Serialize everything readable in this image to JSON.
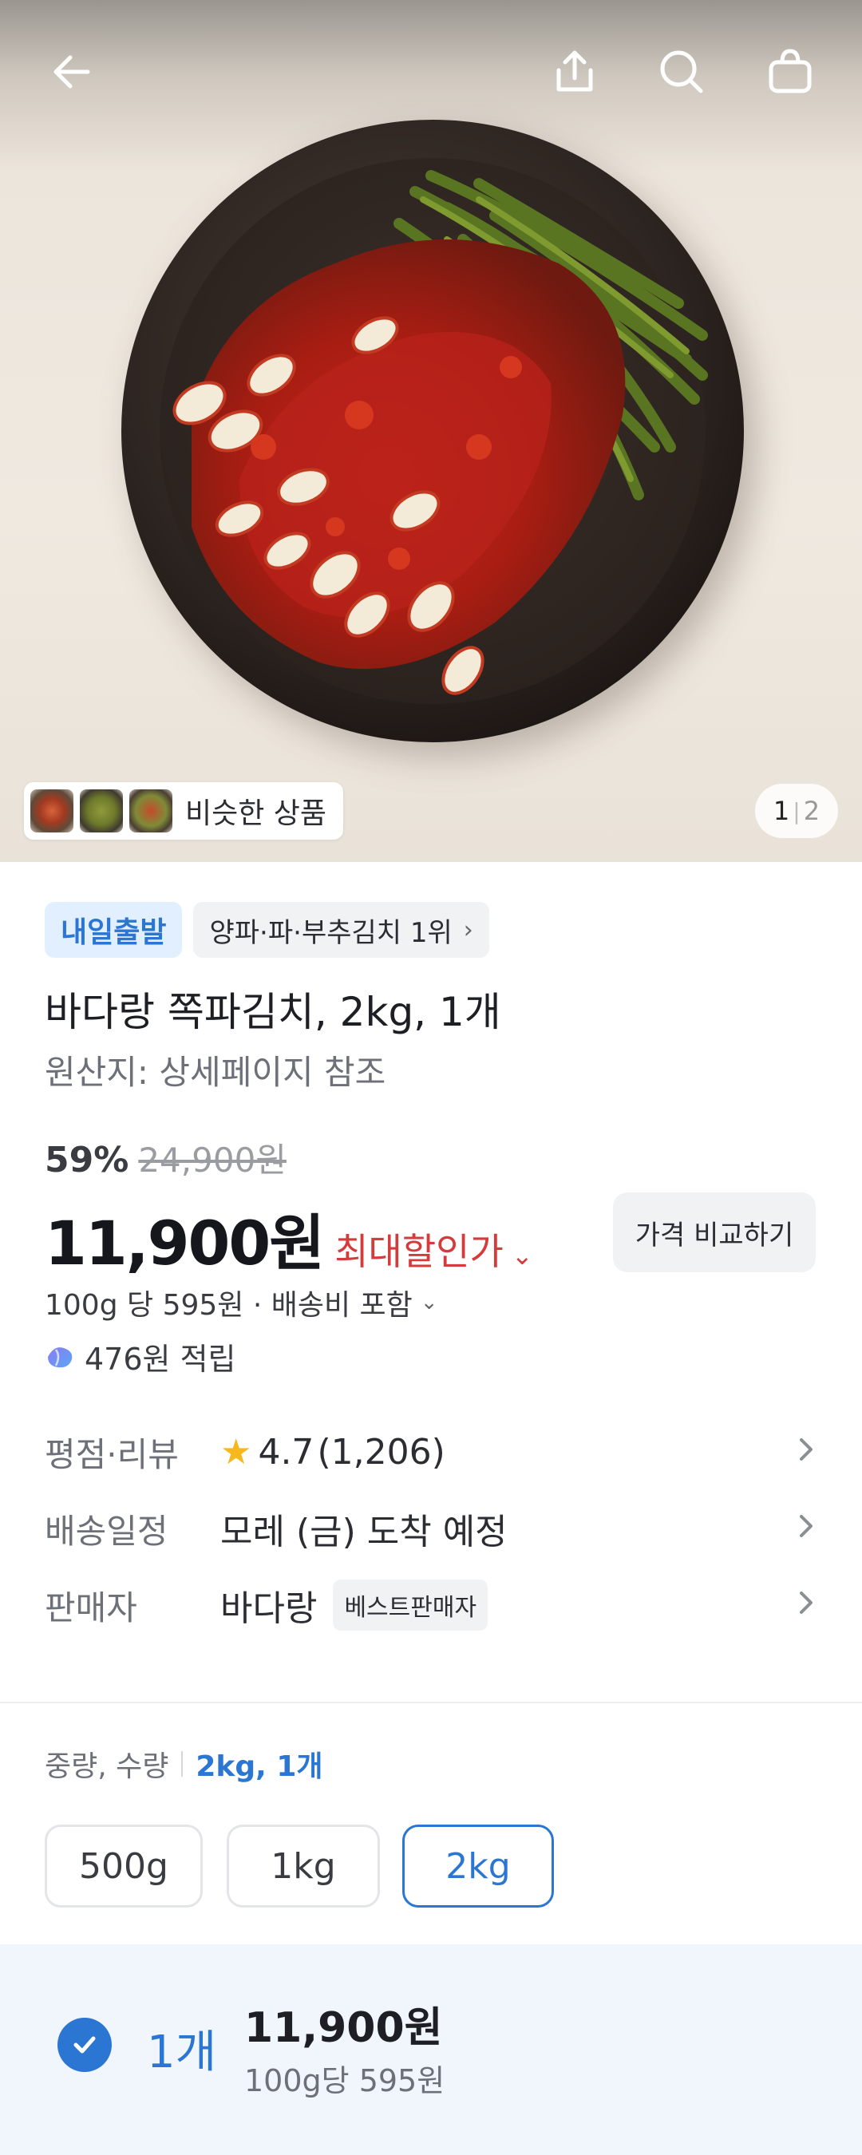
{
  "header": {
    "back_icon": "arrow-left-icon",
    "share_icon": "share-upload-icon",
    "search_icon": "search-icon",
    "cart_icon": "shopping-bag-icon"
  },
  "gallery": {
    "similar_label": "비슷한 상품",
    "page_current": "1",
    "page_total": "2"
  },
  "badges": {
    "delivery": "내일출발",
    "ranking": "양파·파·부추김치 1위"
  },
  "product": {
    "title": "바다랑 쪽파김치, 2kg, 1개",
    "origin": "원산지: 상세페이지 참조",
    "discount_rate": "59%",
    "original_price": "24,900원",
    "price": "11,900원",
    "max_discount_label": "최대할인가",
    "compare_button": "가격 비교하기",
    "unit_price_info": "100g 당 595원 · 배송비 포함",
    "points": "476원 적립"
  },
  "info_rows": {
    "rating": {
      "label": "평점·리뷰",
      "score": "4.7",
      "count": "(1,206)"
    },
    "delivery": {
      "label": "배송일정",
      "value": "모레 (금) 도착 예정"
    },
    "seller": {
      "label": "판매자",
      "value": "바다랑",
      "badge": "베스트판매자"
    }
  },
  "options": {
    "label": "중량, 수량",
    "selected_summary": "2kg, 1개",
    "weights": [
      "500g",
      "1kg",
      "2kg"
    ],
    "selected_weight": "2kg"
  },
  "selection": {
    "quantity": "1개",
    "price": "11,900원",
    "unit_price": "100g당 595원"
  },
  "colors": {
    "accent_blue": "#2a76d2",
    "discount_red": "#d53b3b",
    "star_yellow": "#f6b81d"
  }
}
